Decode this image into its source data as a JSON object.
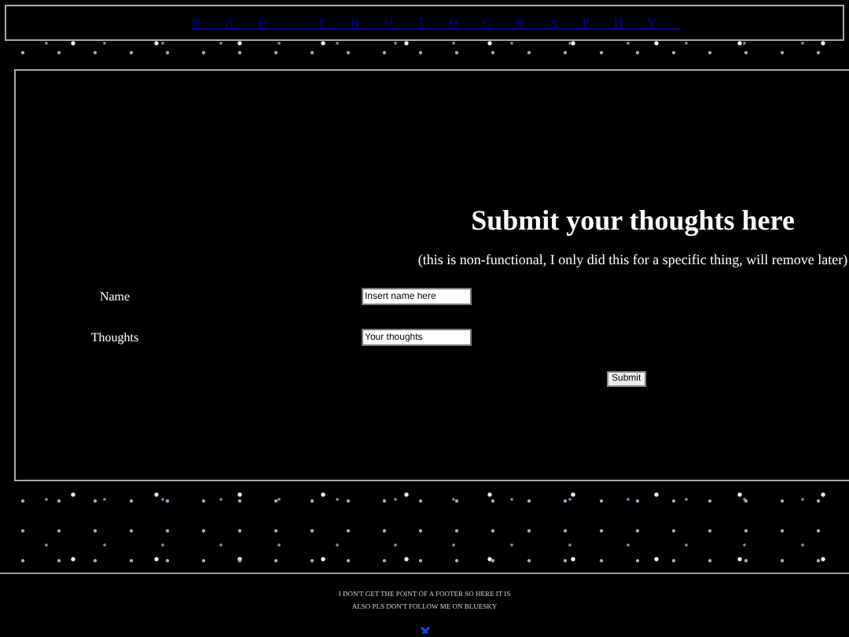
{
  "header": {
    "title": "BAD PHOTOGRAPHY"
  },
  "form": {
    "heading": "Submit your thoughts here",
    "note": "(this is non-functional, I only did this for a specific thing, will remove later)",
    "fields": [
      {
        "label": "Name",
        "placeholder": "Insert name here"
      },
      {
        "label": "Thoughts",
        "placeholder": "Your thoughts"
      }
    ],
    "submit": "Submit"
  },
  "footer": {
    "lines": [
      "I DON'T GET THE POINT OF A FOOTER SO HERE IT IS",
      "ALSO PLS DON'T FOLLOW ME ON BLUESKY"
    ]
  }
}
